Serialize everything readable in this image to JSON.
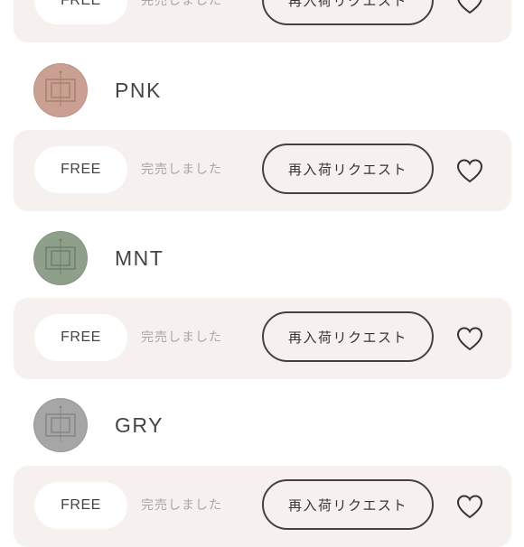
{
  "card_common": {
    "size_label": "FREE",
    "stock_status": "完売しました",
    "restock_label": "再入荷リクエスト",
    "favorite_icon": "heart-outline-icon"
  },
  "colors": [
    {
      "name": "PNK",
      "swatch_color": "#c9a092",
      "swatch_dark": "#b78b7c"
    },
    {
      "name": "MNT",
      "swatch_color": "#8fa08a",
      "swatch_dark": "#7b8c76"
    },
    {
      "name": "GRY",
      "swatch_color": "#a6a6a6",
      "swatch_dark": "#919191"
    }
  ]
}
